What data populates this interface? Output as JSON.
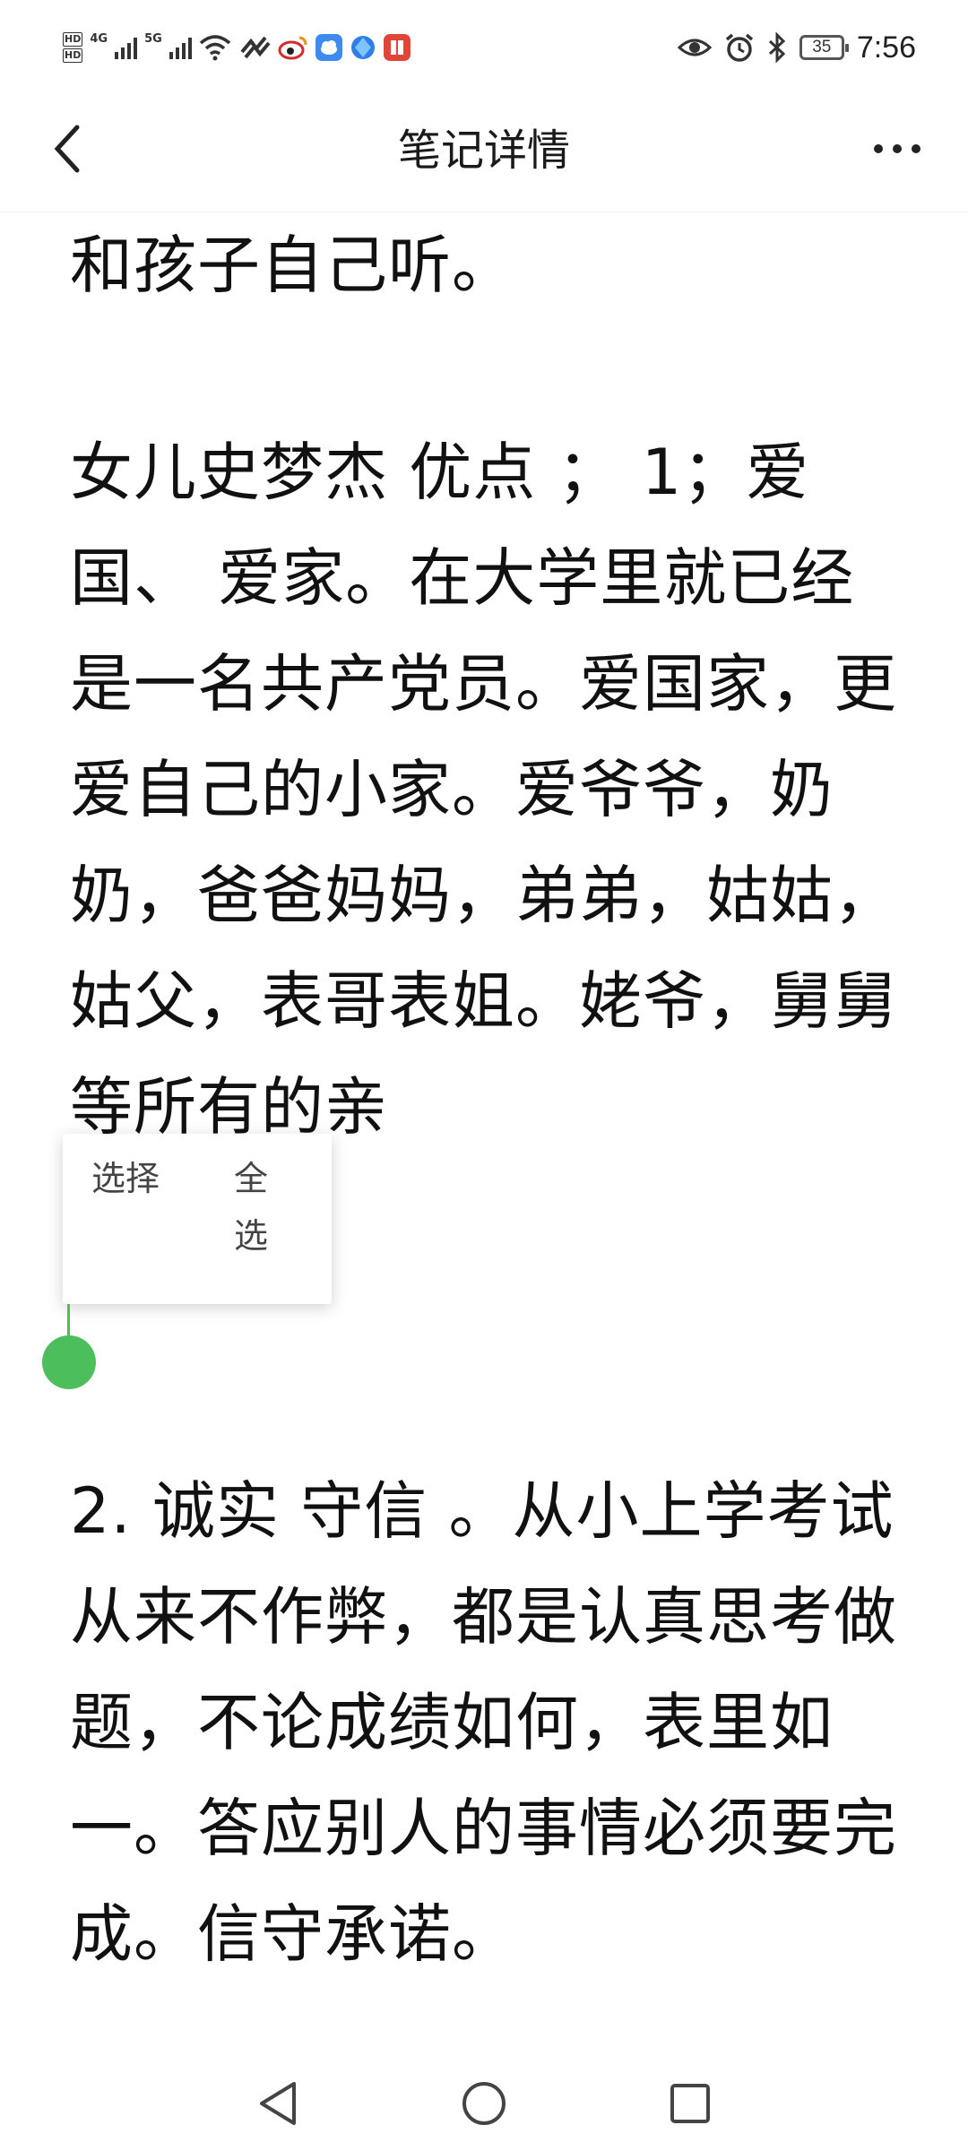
{
  "status_bar": {
    "hd_badges": [
      "HD",
      "HD"
    ],
    "network_1": "4G",
    "network_2": "5G",
    "battery_level": "35",
    "time": "7:56",
    "icons": [
      "signal-icon",
      "signal-icon",
      "wifi-icon",
      "data-saver-icon",
      "weibo-icon",
      "cloud-app-icon",
      "browser-app-icon",
      "book-app-icon",
      "eye-comfort-icon",
      "alarm-icon",
      "bluetooth-icon",
      "battery-icon"
    ]
  },
  "header": {
    "title": "笔记详情",
    "back_icon": "chevron-left-icon",
    "more_icon": "more-dots-icon"
  },
  "note": {
    "paragraphs": [
      "和孩子自己听。",
      "女儿史梦杰 优点 ； 1；爱国、 爱家。在大学里就已经是一名共产党员。爱国家，更爱自己的小家。爱爷爷，奶奶，爸爸妈妈，弟弟，姑姑，姑父，表哥表姐。姥爷，舅舅等所有的亲",
      "2. 诚实 守信 。从小上学考试从来不作弊，都是认真思考做题，不论成绩如何，表里如一。答应别人的事情必须要完成。信守承诺。"
    ]
  },
  "selection_menu": {
    "select_label": "选择",
    "select_all_label": "全\n选"
  },
  "colors": {
    "accent": "#4cbf5c",
    "text": "#111111",
    "background": "#ffffff"
  },
  "nav_bar": {
    "icons": [
      "back-triangle-icon",
      "home-circle-icon",
      "recents-square-icon"
    ]
  }
}
